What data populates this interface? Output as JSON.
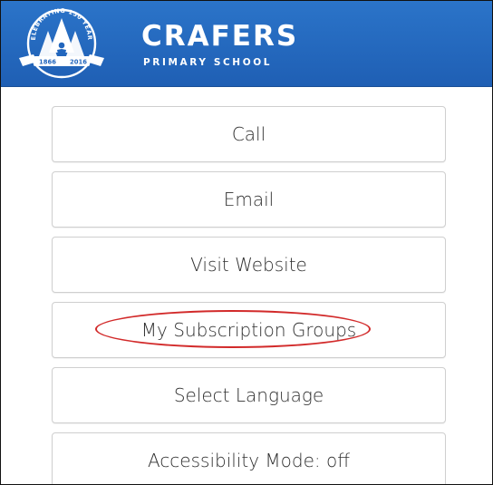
{
  "header": {
    "logo": {
      "badge_text": "CELEBRATING 150 YEARS",
      "year_start": "1866",
      "year_end": "2016"
    },
    "title": "CRAFERS",
    "subtitle": "PRIMARY SCHOOL",
    "colors": {
      "header_bg": "#2266bd",
      "text": "#ffffff"
    }
  },
  "menu": {
    "items": [
      {
        "label": "Call"
      },
      {
        "label": "Email"
      },
      {
        "label": "Visit Website"
      },
      {
        "label": "My Subscription Groups",
        "annotated": true
      },
      {
        "label": "Select Language"
      },
      {
        "label": "Accessibility Mode: off"
      }
    ]
  },
  "annotation": {
    "color": "#d22a2a"
  }
}
